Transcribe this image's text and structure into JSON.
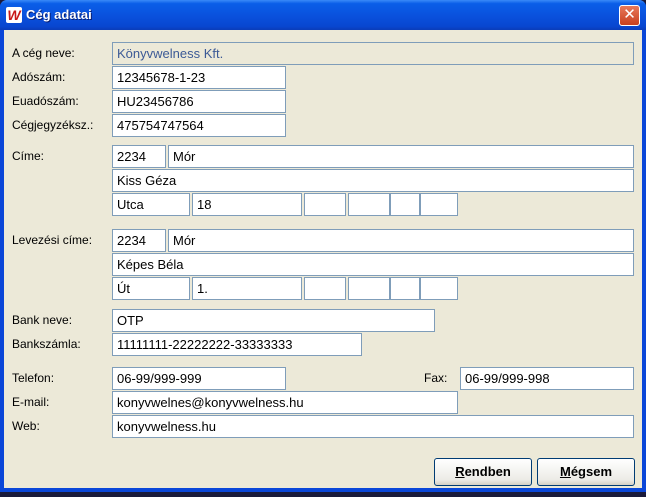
{
  "window": {
    "title": "Cég adatai",
    "close_glyph": "✕",
    "icon_glyph": "W"
  },
  "company": {
    "name_label": "A cég neve:",
    "name_value": "Könyvwelness Kft.",
    "tax_label": "Adószám:",
    "tax_value": "12345678-1-23",
    "eu_tax_label": "Euadószám:",
    "eu_tax_value": "HU23456786",
    "reg_label": "Cégjegyzéksz.:",
    "reg_value": "475754747564"
  },
  "address": {
    "label": "Címe:",
    "zip": "2234",
    "city": "Mór",
    "name": "Kiss Géza",
    "street_type": "Utca",
    "number": "18",
    "building": "",
    "stairway": "",
    "floor": "",
    "door": ""
  },
  "mailing": {
    "label": "Levezési címe:",
    "zip": "2234",
    "city": "Mór",
    "name": "Képes Béla",
    "street_type": "Út",
    "number": "1.",
    "building": "",
    "stairway": "",
    "floor": "",
    "door": ""
  },
  "bank": {
    "name_label": "Bank neve:",
    "name_value": "OTP",
    "account_label": "Bankszámla:",
    "account_value": "11111111-22222222-33333333"
  },
  "contact": {
    "phone_label": "Telefon:",
    "phone_value": "06-99/999-999",
    "fax_label": "Fax:",
    "fax_value": "06-99/999-998",
    "email_label": "E-mail:",
    "email_value": "konyvwelnes@konyvwelness.hu",
    "web_label": "Web:",
    "web_value": "konyvwelness.hu"
  },
  "buttons": {
    "ok_hotkey": "R",
    "ok_rest": "endben",
    "cancel_hotkey": "M",
    "cancel_rest": "égsem"
  }
}
